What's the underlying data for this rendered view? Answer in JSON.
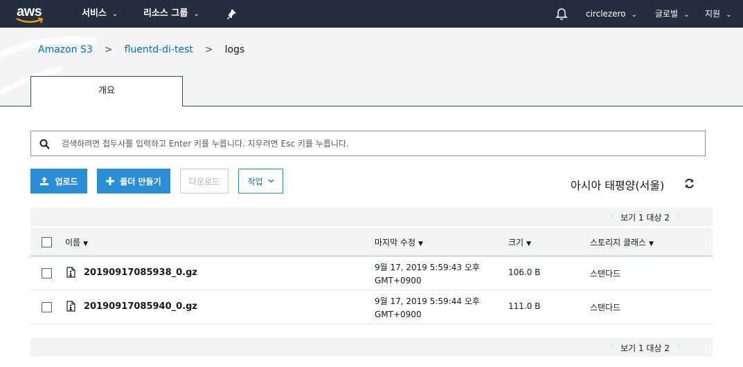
{
  "nav": {
    "logo": "aws",
    "services": "서비스",
    "resource_groups": "리소스 그룹",
    "user": "circlezero",
    "region_menu": "글로벌",
    "support": "지원"
  },
  "breadcrumb": {
    "root": "Amazon S3",
    "bucket": "fluentd-di-test",
    "folder": "logs",
    "separator": ">"
  },
  "tabs": [
    {
      "label": "개요"
    }
  ],
  "search": {
    "placeholder": "검색하려면 접두사를 입력하고 Enter 키를 누릅니다. 지우려면 Esc 키를 누릅니다."
  },
  "toolbar": {
    "upload": "업로드",
    "create_folder": "폴더 만들기",
    "download": "다운로드",
    "actions": "작업",
    "region": "아시아 태평양(서울)"
  },
  "pager": {
    "text": "보기 1 대상 2",
    "prev": "‹",
    "next": "›"
  },
  "table": {
    "columns": {
      "name": "이름",
      "modified": "마지막 수정",
      "size": "크기",
      "storage_class": "스토리지 클래스",
      "sort_glyph": "▼"
    },
    "rows": [
      {
        "name": "20190917085938_0.gz",
        "modified_line1": "9월 17, 2019 5:59:43 오후",
        "modified_line2": "GMT+0900",
        "size": "106.0 B",
        "storage_class": "스탠다드"
      },
      {
        "name": "20190917085940_0.gz",
        "modified_line1": "9월 17, 2019 5:59:44 오후",
        "modified_line2": "GMT+0900",
        "size": "111.0 B",
        "storage_class": "스탠다드"
      }
    ]
  },
  "colors": {
    "nav_bg": "#232f3e",
    "link": "#0073bb",
    "primary_button": "#2a8ed6",
    "aws_smile": "#ff9900"
  },
  "icons": [
    "aws-smile-icon",
    "chevron-down-icon",
    "pin-icon",
    "bell-icon",
    "search-icon",
    "upload-icon",
    "plus-icon",
    "refresh-icon",
    "file-icon",
    "sort-down-icon"
  ]
}
